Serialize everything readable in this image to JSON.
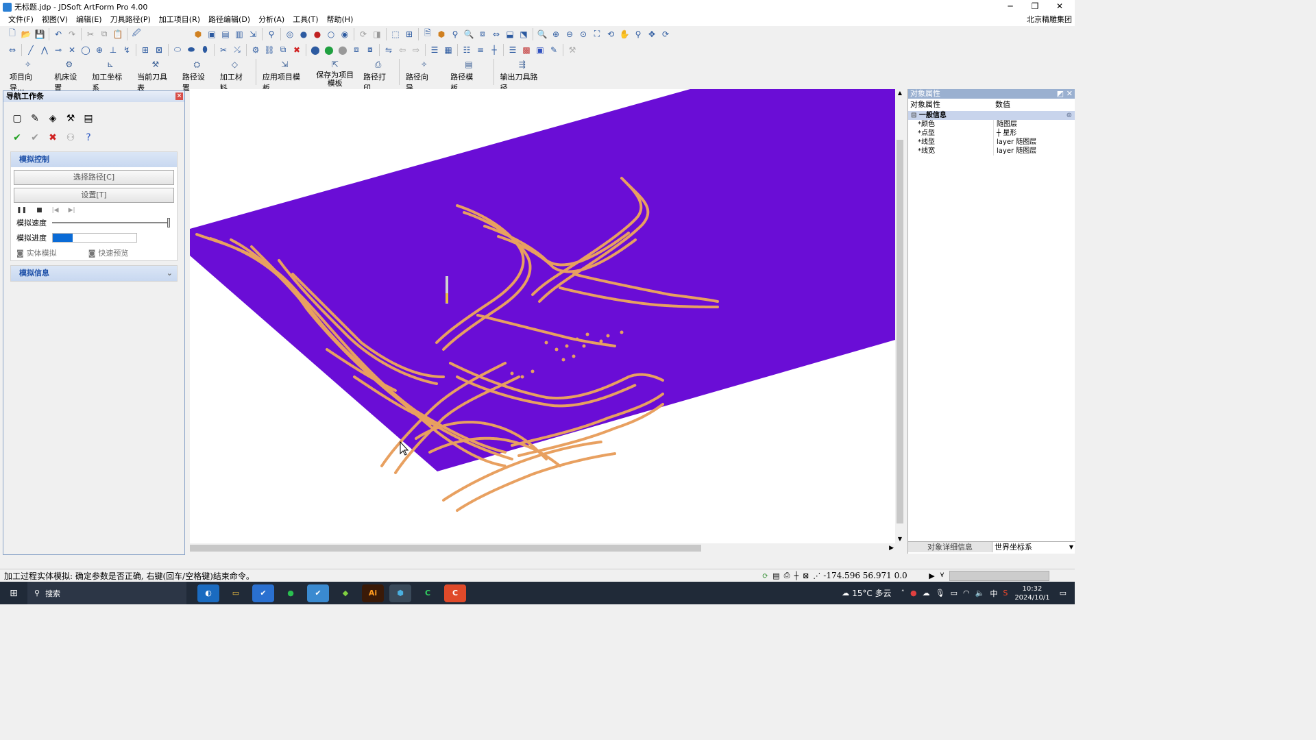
{
  "window": {
    "title": "无标题.jdp - JDSoft ArtForm Pro 4.00",
    "minimize": "─",
    "restore": "❐",
    "close": "✕"
  },
  "menu": {
    "items": [
      "文件(F)",
      "视图(V)",
      "编辑(E)",
      "刀具路径(P)",
      "加工项目(R)",
      "路径编辑(D)",
      "分析(A)",
      "工具(T)",
      "帮助(H)"
    ],
    "company": "北京精雕集团"
  },
  "big_toolbar": {
    "buttons": [
      "项目向导...",
      "机床设置",
      "加工坐标系",
      "当前刀具表",
      "路径设置",
      "加工材料",
      "应用项目模板",
      "保存为项目模板",
      "路径打印",
      "路径向导...",
      "路径模板...",
      "输出刀具路径"
    ]
  },
  "nav_panel": {
    "title": "导航工作条",
    "section1_title": "模拟控制",
    "select_path_button": "选择路径[C]",
    "settings_button": "设置[T]",
    "speed_label": "模拟速度",
    "progress_label": "模拟进度",
    "progress_value": 0.24,
    "solid_sim_label": "实体模拟",
    "quick_preview_label": "快速预览",
    "section2_title": "模拟信息"
  },
  "prop_panel": {
    "title": "对象属性",
    "col_prop": "对象属性",
    "col_value": "数值",
    "group_title": "一般信息",
    "rows": [
      {
        "key": "*颜色",
        "value": "随图层"
      },
      {
        "key": "*点型",
        "value": "┼ 星形"
      },
      {
        "key": "*线型",
        "value": "layer 随图层"
      },
      {
        "key": "*线宽",
        "value": "layer 随图层"
      }
    ],
    "detail_button": "对象详细信息",
    "coord_select": "世界坐标系"
  },
  "status": {
    "message": "加工过程实体模拟: 确定参数是否正确, 右键(回车/空格键)结束命令。",
    "coords": "-174.596 56.971 0.0"
  },
  "taskbar": {
    "search": "搜索",
    "weather": "15°C 多云",
    "ime": "中",
    "time": "10:32",
    "date": "2024/10/1"
  },
  "colors": {
    "stock": "#6a0dd6",
    "toolpath": "#e8a060",
    "accent": "#1c4fa8"
  }
}
